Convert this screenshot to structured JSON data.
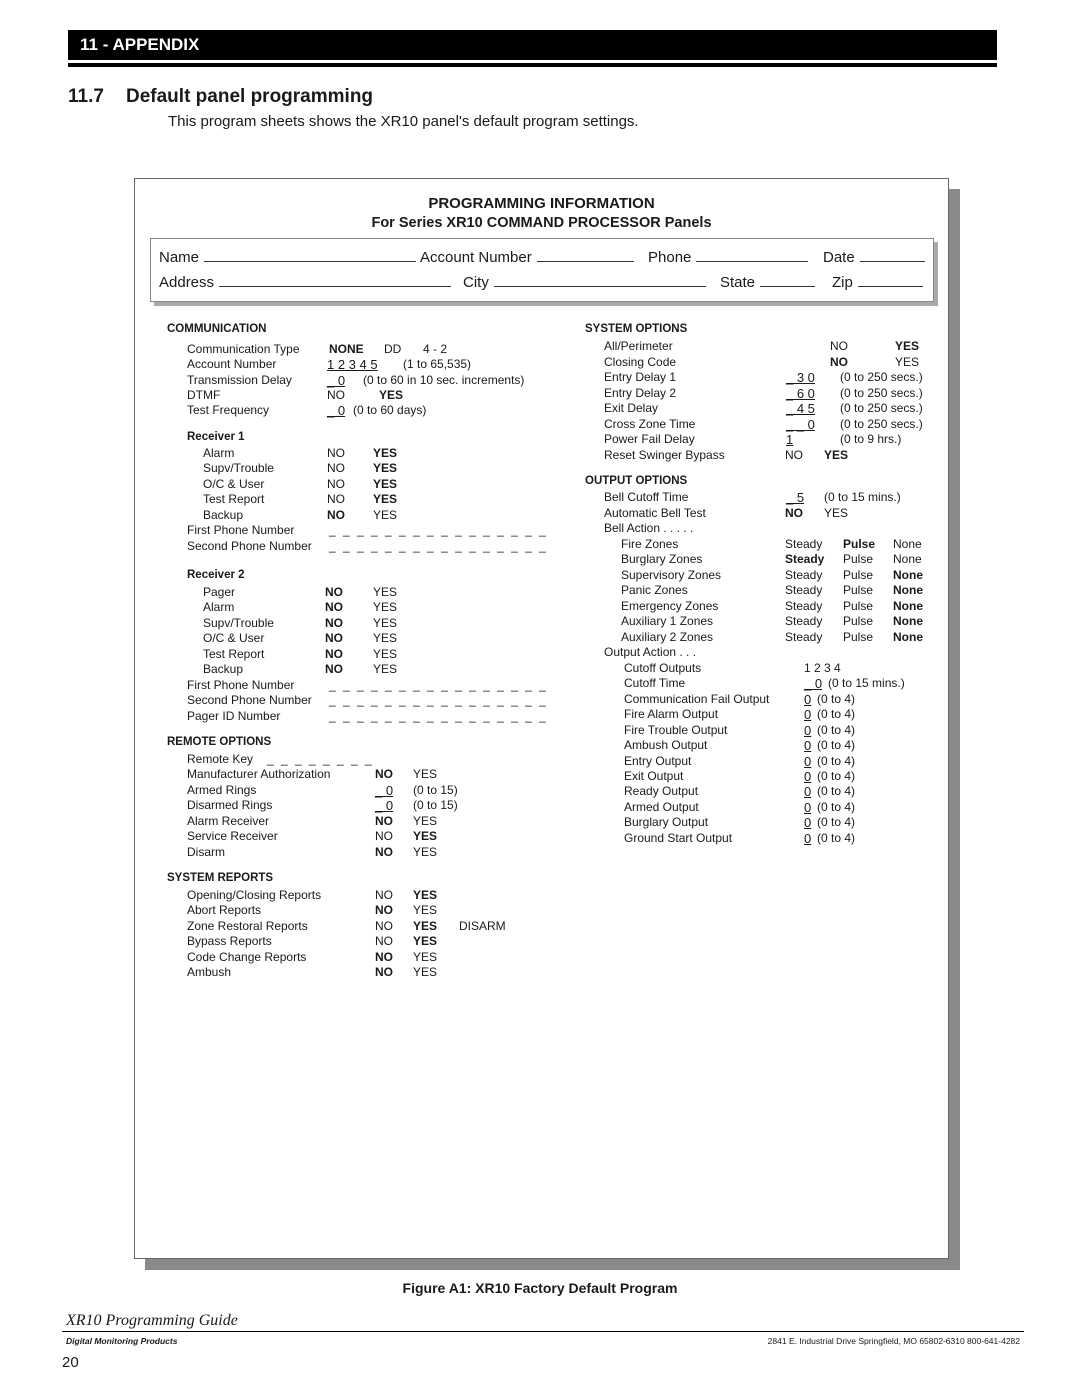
{
  "header": {
    "chapter": "11 - APPENDIX"
  },
  "section": {
    "number": "11.7",
    "title": "Default panel programming"
  },
  "intro": "This program sheets shows the XR10 panel's default program settings.",
  "form": {
    "title": "PROGRAMMING INFORMATION",
    "subtitle": "For Series XR10 COMMAND PROCESSOR Panels",
    "info_fields": {
      "name": "Name",
      "account_number": "Account Number",
      "phone": "Phone",
      "date": "Date",
      "address": "Address",
      "city": "City",
      "state": "State",
      "zip": "Zip"
    },
    "communication": {
      "heading": "COMMUNICATION",
      "rows": [
        {
          "label": "Communication Type",
          "a": "NONE",
          "b": "DD",
          "c": "4 - 2"
        },
        {
          "label": "Account Number",
          "a": "1 2 3 4 5",
          "c": "(1 to 65,535)"
        },
        {
          "label": "Transmission Delay",
          "a": "_ 0",
          "c": "(0 to 60 in 10 sec. increments)"
        },
        {
          "label": "DTMF",
          "a": "NO",
          "b": "YES"
        },
        {
          "label": "Test Frequency",
          "a": "_ 0",
          "c": "(0 to 60 days)"
        }
      ],
      "receiver1": {
        "heading": "Receiver 1",
        "rows": [
          {
            "label": "Alarm",
            "no": "NO",
            "yes": "YES"
          },
          {
            "label": "Supv/Trouble",
            "no": "NO",
            "yes": "YES"
          },
          {
            "label": "O/C  & User",
            "no": "NO",
            "yes": "YES"
          },
          {
            "label": "Test Report",
            "no": "NO",
            "yes": "YES"
          },
          {
            "label": "Backup",
            "no": "NO",
            "yes": "YES"
          }
        ],
        "first_phone": "First Phone Number",
        "second_phone": "Second Phone Number",
        "blank": "_ _ _ _ _ _ _ _ _ _ _ _ _ _ _ _"
      },
      "receiver2": {
        "heading": "Receiver 2",
        "rows": [
          {
            "label": "Pager",
            "no": "NO",
            "yes": "YES"
          },
          {
            "label": "Alarm",
            "no": "NO",
            "yes": "YES"
          },
          {
            "label": "Supv/Trouble",
            "no": "NO",
            "yes": "YES"
          },
          {
            "label": "O/C  & User",
            "no": "NO",
            "yes": "YES"
          },
          {
            "label": "Test Report",
            "no": "NO",
            "yes": "YES"
          },
          {
            "label": "Backup",
            "no": "NO",
            "yes": "YES"
          }
        ],
        "first_phone": "First Phone Number",
        "second_phone": "Second Phone Number",
        "pager_id": "Pager ID Number",
        "blank": "_ _ _ _ _ _ _ _ _ _ _ _ _ _ _ _"
      }
    },
    "remote_options": {
      "heading": "REMOTE OPTIONS",
      "remote_key": {
        "label": "Remote Key",
        "value": "_ _ _ _ _ _ _ _"
      },
      "rows": [
        {
          "label": "Manufacturer Authorization",
          "a": "NO",
          "b": "YES"
        },
        {
          "label": "Armed Rings",
          "a": "_ 0",
          "b": "(0 to 15)"
        },
        {
          "label": "Disarmed Rings",
          "a": "_ 0",
          "b": "(0 to 15)"
        },
        {
          "label": "Alarm Receiver",
          "a": "NO",
          "b": "YES"
        },
        {
          "label": "Service Receiver",
          "a": "NO",
          "b": "YES"
        },
        {
          "label": "Disarm",
          "a": "NO",
          "b": "YES"
        }
      ]
    },
    "system_reports": {
      "heading": "SYSTEM REPORTS",
      "rows": [
        {
          "label": "Opening/Closing Reports",
          "a": "NO",
          "b": "YES"
        },
        {
          "label": "Abort Reports",
          "a": "NO",
          "b": "YES"
        },
        {
          "label": "Zone Restoral Reports",
          "a": "NO",
          "b": "YES",
          "c": "DISARM"
        },
        {
          "label": "Bypass Reports",
          "a": "NO",
          "b": "YES"
        },
        {
          "label": "Code Change Reports",
          "a": "NO",
          "b": "YES"
        },
        {
          "label": "Ambush",
          "a": "NO",
          "b": "YES"
        }
      ]
    },
    "system_options": {
      "heading": "SYSTEM OPTIONS",
      "rows": [
        {
          "label": "All/Perimeter",
          "a": "NO",
          "b": "YES"
        },
        {
          "label": "Closing Code",
          "a": "NO",
          "b": "YES"
        },
        {
          "label": "Entry Delay 1",
          "a": "_ 3 0",
          "b": "(0 to 250 secs.)"
        },
        {
          "label": "Entry Delay 2",
          "a": "_ 6 0",
          "b": "(0 to 250 secs.)"
        },
        {
          "label": "Exit Delay",
          "a": "_ 4 5",
          "b": "(0 to 250 secs.)"
        },
        {
          "label": "Cross Zone Time",
          "a": "_ _ 0",
          "b": "(0 to 250 secs.)"
        },
        {
          "label": "Power Fail Delay",
          "a": "1",
          "b": "(0 to 9  hrs.)"
        },
        {
          "label": "Reset Swinger Bypass",
          "a": "NO",
          "b": "YES"
        }
      ]
    },
    "output_options": {
      "heading": "OUTPUT OPTIONS",
      "bell_cutoff": {
        "label": "Bell Cutoff Time",
        "a": "_ 5",
        "b": "(0 to 15 mins.)"
      },
      "auto_bell_test": {
        "label": "Automatic Bell Test",
        "a": "NO",
        "b": "YES"
      },
      "bell_action": "Bell Action . . . . .",
      "bell_rows": [
        {
          "label": "Fire Zones",
          "steady": "Steady",
          "pulse": "Pulse",
          "none": "None"
        },
        {
          "label": "Burglary Zones",
          "steady": "Steady",
          "pulse": "Pulse",
          "none": "None"
        },
        {
          "label": "Supervisory Zones",
          "steady": "Steady",
          "pulse": "Pulse",
          "none": "None"
        },
        {
          "label": "Panic Zones",
          "steady": "Steady",
          "pulse": "Pulse",
          "none": "None"
        },
        {
          "label": "Emergency Zones",
          "steady": "Steady",
          "pulse": "Pulse",
          "none": "None"
        },
        {
          "label": "Auxiliary 1 Zones",
          "steady": "Steady",
          "pulse": "Pulse",
          "none": "None"
        },
        {
          "label": "Auxiliary 2 Zones",
          "steady": "Steady",
          "pulse": "Pulse",
          "none": "None"
        }
      ],
      "output_action": "Output Action . . .",
      "cutoff_outputs": {
        "label": "Cutoff Outputs",
        "value": "1 2 3 4"
      },
      "cutoff_time": {
        "label": "Cutoff Time",
        "a": "_ 0",
        "b": "(0 to 15 mins.)"
      },
      "outputs": [
        {
          "label": "Communication Fail Output",
          "value": "0",
          "range": "(0 to 4)"
        },
        {
          "label": "Fire Alarm Output",
          "value": "0",
          "range": "(0 to 4)"
        },
        {
          "label": "Fire Trouble Output",
          "value": "0",
          "range": "(0 to 4)"
        },
        {
          "label": "Ambush Output",
          "value": "0",
          "range": "(0 to 4)"
        },
        {
          "label": "Entry Output",
          "value": "0",
          "range": "(0 to 4)"
        },
        {
          "label": "Exit Output",
          "value": "0",
          "range": "(0 to 4)"
        },
        {
          "label": "Ready Output",
          "value": "0",
          "range": "(0 to 4)"
        },
        {
          "label": "Armed Output",
          "value": "0",
          "range": "(0 to 4)"
        },
        {
          "label": "Burglary Output",
          "value": "0",
          "range": "(0 to 4)"
        },
        {
          "label": "Ground Start Output",
          "value": "0",
          "range": "(0 to 4)"
        }
      ]
    }
  },
  "caption": "Figure A1: XR10 Factory Default Program",
  "footer": {
    "guide": "XR10 Programming Guide",
    "company": "Digital Monitoring Products",
    "address": "2841 E. Industrial Drive  Springfield, MO  65802-6310  800-641-4282",
    "page": "20"
  }
}
